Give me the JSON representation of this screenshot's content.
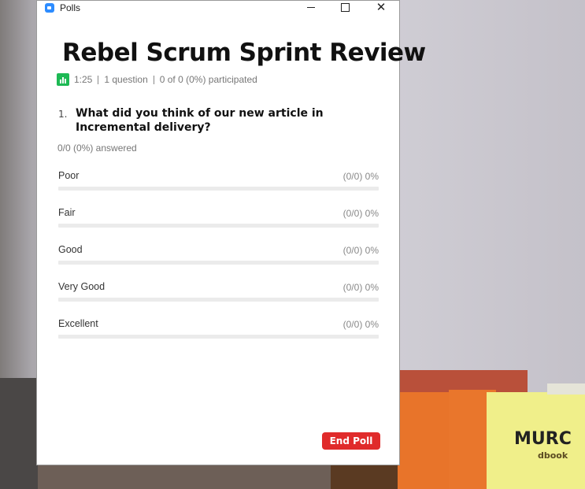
{
  "window": {
    "title": "Polls",
    "close_glyph": "✕"
  },
  "poll": {
    "title": "Rebel Scrum Sprint Review",
    "elapsed": "1:25",
    "questions": "1 question",
    "participation": "0 of 0 (0%) participated",
    "question_number": "1.",
    "question_text": "What did you think of our new article in Incremental delivery?",
    "answered": "0/0 (0%) answered",
    "options": [
      {
        "label": "Poor",
        "result": "(0/0) 0%",
        "percent": 0
      },
      {
        "label": "Fair",
        "result": "(0/0) 0%",
        "percent": 0
      },
      {
        "label": "Good",
        "result": "(0/0) 0%",
        "percent": 0
      },
      {
        "label": "Very Good",
        "result": "(0/0) 0%",
        "percent": 0
      },
      {
        "label": "Excellent",
        "result": "(0/0) 0%",
        "percent": 0
      }
    ],
    "end_button": "End Poll"
  },
  "background": {
    "book_text": "MURC",
    "book_subtext": "dbook"
  },
  "colors": {
    "accent": "#2d8cff",
    "danger": "#e02b2b",
    "success": "#1db954"
  },
  "icons": {
    "app": "zoom-camera-icon",
    "stats": "bar-chart-icon"
  }
}
